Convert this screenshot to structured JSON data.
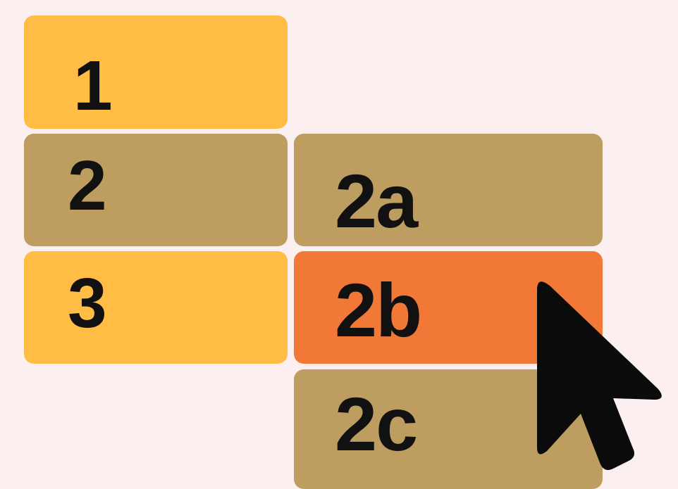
{
  "menu": {
    "items": [
      {
        "label": "1",
        "color": "#ffbd45"
      },
      {
        "label": "2",
        "color": "#be9d60"
      },
      {
        "label": "3",
        "color": "#ffbd45"
      }
    ]
  },
  "submenu": {
    "parent": "2",
    "items": [
      {
        "label": "2a",
        "color": "#be9d60"
      },
      {
        "label": "2b",
        "color": "#f27838",
        "state": "hovered"
      },
      {
        "label": "2c",
        "color": "#be9d60"
      }
    ]
  },
  "cursor": {
    "icon": "arrow-pointer-icon",
    "color": "#0b0b0b"
  },
  "colors": {
    "background": "#fbeff0",
    "text": "#111111"
  }
}
